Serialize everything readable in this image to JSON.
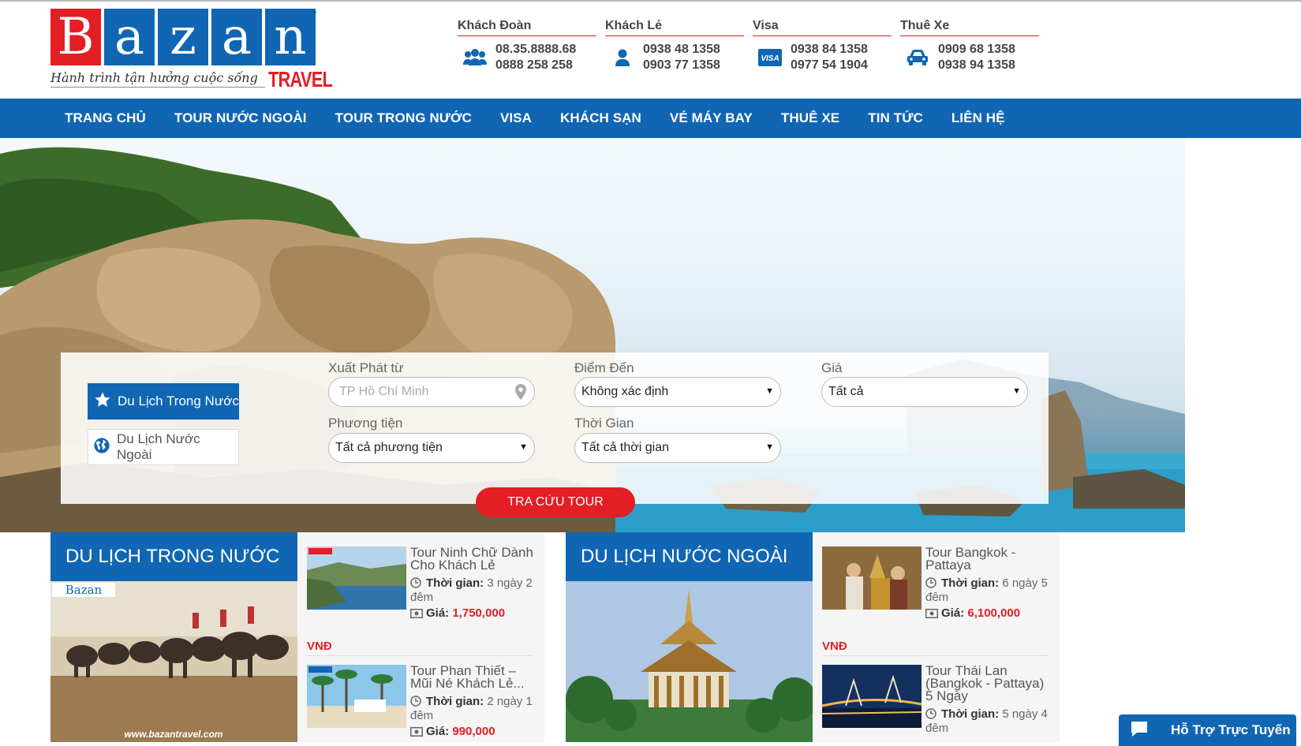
{
  "logo": {
    "letters": [
      "B",
      "a",
      "z",
      "a",
      "n"
    ],
    "slogan": "Hành trình tận hưởng cuộc sống",
    "travel": "TRAVEL",
    "registered": "®"
  },
  "contacts": [
    {
      "title": "Khách Đoàn",
      "icon": "group-icon",
      "phones": [
        "08.35.8888.68",
        "0888 258 258"
      ]
    },
    {
      "title": "Khách Lẻ",
      "icon": "user-icon",
      "phones": [
        "0938 48 1358",
        "0903 77 1358"
      ]
    },
    {
      "title": "Visa",
      "icon": "visa-card-icon",
      "phones": [
        "0938 84 1358",
        "0977 54 1904"
      ]
    },
    {
      "title": "Thuê Xe",
      "icon": "car-icon",
      "phones": [
        "0909 68 1358",
        "0938 94 1358"
      ]
    }
  ],
  "nav": [
    "TRANG CHỦ",
    "TOUR NƯỚC NGOÀI",
    "TOUR TRONG NƯỚC",
    "VISA",
    "KHÁCH SẠN",
    "VÉ MÁY BAY",
    "THUÊ XE",
    "TIN TỨC",
    "LIÊN HỆ"
  ],
  "search": {
    "tab_domestic": "Du Lịch Trong Nước",
    "tab_international": "Du Lịch Nước Ngoài",
    "from_label": "Xuất Phát từ",
    "from_placeholder": "TP Hồ Chí Minh",
    "destination_label": "Điểm Đến",
    "destination_value": "Không xác định",
    "price_label": "Giá",
    "price_value": "Tất cả",
    "transport_label": "Phương tiện",
    "transport_value": "Tất cả phương tiện",
    "time_label": "Thời Gian",
    "time_value": "Tất cả thời gian",
    "button": "TRA CỨU TOUR"
  },
  "domestic": {
    "heading": "DU LỊCH TRONG NƯỚC",
    "image_url_caption": "www.bazantravel.com",
    "image_logo": "Bazan",
    "tours": [
      {
        "name": "Tour Ninh Chữ Dành Cho Khách Lẻ",
        "time_label": "Thời gian:",
        "time": "3 ngày 2 đêm",
        "price_label": "Giá:",
        "price": "1,750,000",
        "currency": "VNĐ"
      },
      {
        "name": "Tour Phan Thiết – Mũi Né Khách Lẻ...",
        "time_label": "Thời gian:",
        "time": "2 ngày 1 đêm",
        "price_label": "Giá:",
        "price": "990,000"
      }
    ]
  },
  "international": {
    "heading": "DU LỊCH NƯỚC NGOÀI",
    "tours": [
      {
        "name": "Tour Bangkok - Pattaya",
        "time_label": "Thời gian:",
        "time": "6 ngày 5 đêm",
        "price_label": "Giá:",
        "price": "6,100,000",
        "currency": "VNĐ"
      },
      {
        "name": "Tour Thái Lan (Bangkok - Pattaya) 5 Ngày",
        "time_label": "Thời gian:",
        "time": "5 ngày 4 đêm"
      }
    ]
  },
  "chat": {
    "label": "Hỗ Trợ Trực Tuyến"
  },
  "colors": {
    "brand_blue": "#1066b3",
    "brand_red": "#e31e25"
  }
}
